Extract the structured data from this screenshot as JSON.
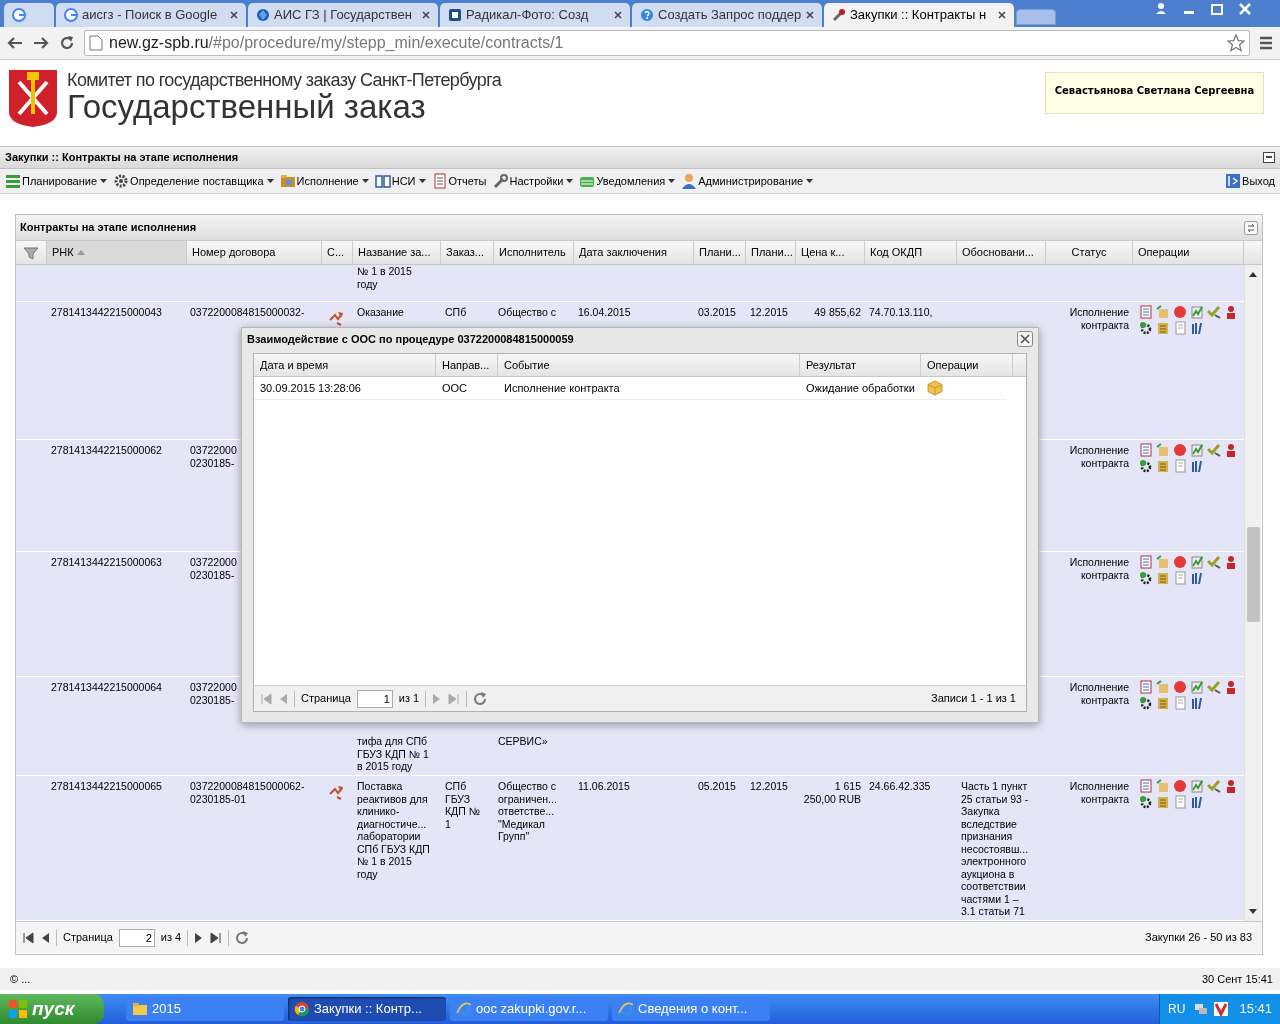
{
  "browser": {
    "tabs": [
      {
        "kind": "google",
        "selected": false
      },
      {
        "kind": "google",
        "title": "аисгз - Поиск в Google",
        "selected": false
      },
      {
        "kind": "globe",
        "title": "АИС ГЗ | Государствен",
        "selected": false
      },
      {
        "kind": "photo",
        "title": "Радикал-Фото: Созд",
        "selected": false
      },
      {
        "kind": "help",
        "title": "Создать Запрос поддер",
        "selected": false
      },
      {
        "kind": "tools",
        "title": "Закупки :: Контракты н",
        "selected": true
      }
    ],
    "url_host": "new.gz-spb.ru",
    "url_path": "/#po/procedure/my/stepp_min/execute/contracts/1"
  },
  "header": {
    "org": "Комитет по государственному заказу Санкт-Петербурга",
    "title": "Государственный заказ",
    "user": "Севастьянова Светлана Сергеевна"
  },
  "panel_title": "Закупки :: Контракты на этапе исполнения",
  "menu": [
    {
      "label": "Планирование",
      "dropdown": true
    },
    {
      "label": "Определение поставщика",
      "dropdown": true
    },
    {
      "label": "Исполнение",
      "dropdown": true
    },
    {
      "label": "НСИ",
      "dropdown": true
    },
    {
      "label": "Отчеты",
      "dropdown": false
    },
    {
      "label": "Настройки",
      "dropdown": true
    },
    {
      "label": "Уведомления",
      "dropdown": true
    },
    {
      "label": "Администрирование",
      "dropdown": true
    }
  ],
  "logout": "Выход",
  "grid": {
    "title": "Контракты на этапе исполнения",
    "columns": [
      {
        "label": "РНК",
        "sorted": true
      },
      {
        "label": "Номер договора",
        "sorted": false
      },
      {
        "label": "С...",
        "sorted": false
      },
      {
        "label": "Название за...",
        "sorted": false
      },
      {
        "label": "Заказ...",
        "sorted": false
      },
      {
        "label": "Исполнитель",
        "sorted": false
      },
      {
        "label": "Дата заключения",
        "sorted": false
      },
      {
        "label": "Плани...",
        "sorted": false
      },
      {
        "label": "Плани...",
        "sorted": false
      },
      {
        "label": "Цена к...",
        "sorted": false
      },
      {
        "label": "Код ОКДП",
        "sorted": false
      },
      {
        "label": "Обосновани...",
        "sorted": false
      },
      {
        "label": "Статус",
        "sorted": false
      },
      {
        "label": "Операции",
        "sorted": false
      }
    ],
    "rows": [
      {
        "cells": [
          "",
          "",
          "",
          "№ 1 в 2015\nгоду",
          "",
          "",
          "",
          "",
          "",
          "",
          "",
          "",
          "",
          ""
        ],
        "flag": false,
        "ops": false
      },
      {
        "cells": [
          "2781413442215000043",
          "0372200084815000032-",
          "",
          "Оказание",
          "СПб",
          "Общество с",
          "16.04.2015",
          "03.2015",
          "12.2015",
          "49 855,62",
          "74.70.13.110,",
          "",
          "Исполнение\nконтракта"
        ],
        "flag": true,
        "ops": true
      },
      {
        "cells": [
          "2781413442215000062",
          "03722000\n0230185-",
          "",
          "",
          "",
          "",
          "",
          "",
          "",
          "",
          "",
          "",
          "Исполнение\nконтракта"
        ],
        "flag": false,
        "ops": true
      },
      {
        "cells": [
          "2781413442215000063",
          "03722000\n0230185-",
          "",
          "",
          "",
          "",
          "",
          "",
          "",
          "",
          "",
          "",
          "Исполнение\nконтракта"
        ],
        "flag": false,
        "ops": true
      },
      {
        "cells": [
          "2781413442215000064",
          "03722000\n0230185-",
          "",
          "тифа для СПб\nГБУЗ КДП № 1\nв 2015 году",
          "",
          "СЕРВИС»",
          "",
          "",
          "",
          "",
          "",
          "",
          "Исполнение\nконтракта"
        ],
        "flag": false,
        "ops": true
      },
      {
        "cells": [
          "2781413442215000065",
          "0372200084815000062-\n0230185-01",
          "",
          "Поставка\nреактивов для\nклинико-\nдиагностиче...\nлаборатории\nСПб ГБУЗ КДП\n№ 1 в 2015\nгоду",
          "СПб\nГБУЗ\nКДП №\n1",
          "Общество с\nограничен...\nответстве...\n\"Медикал\nГрупп\"",
          "11.06.2015",
          "05.2015",
          "12.2015",
          "1 615\n250,00 RUB",
          "24.66.42.335",
          "Часть 1 пункт\n25 статьи 93 -\nЗакупка\nвследствие\nпризнания\nнесостоявш...\nэлектронного\nаукциона в\nсоответствии\nчастями 1 –\n3.1 статьи 71",
          "Исполнение\nконтракта"
        ],
        "flag": true,
        "ops": true
      }
    ],
    "pager": {
      "page_label": "Страница",
      "page": "2",
      "of": "из 4",
      "summary": "Закупки 26 - 50 из 83"
    }
  },
  "dialog": {
    "title": "Взаимодействие с ООС по процедуре 0372200084815000059",
    "columns": [
      "Дата и время",
      "Направ...",
      "Событие",
      "Результат",
      "Операции"
    ],
    "rows": [
      {
        "cells": [
          "30.09.2015 13:28:06",
          "ООС",
          "Исполнение контракта",
          "Ожидание обработки"
        ]
      }
    ],
    "pager": {
      "page_label": "Страница",
      "page": "1",
      "of": "из 1",
      "summary": "Записи 1 - 1 из 1"
    }
  },
  "status_bar": {
    "left": "© ...",
    "right": "30 Сент 15:41"
  },
  "taskbar": {
    "start": "пуск",
    "items": [
      {
        "kind": "folder",
        "label": "2015",
        "selected": false
      },
      {
        "kind": "chrome",
        "label": "Закупки :: Контр...",
        "selected": true
      },
      {
        "kind": "ie",
        "label": "оос zakupki.gov.r...",
        "selected": false
      },
      {
        "kind": "ie",
        "label": "Сведения о конт...",
        "selected": false
      }
    ],
    "lang": "RU",
    "time": "15:41"
  }
}
